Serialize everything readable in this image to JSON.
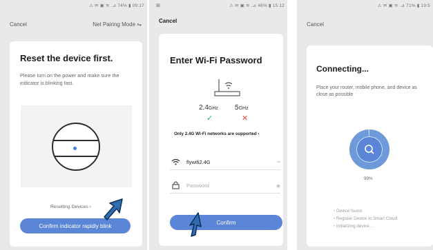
{
  "panel1": {
    "status_bar": "⚠ ✉ ▣ ≋ .⊿ 74% ▮ 09:17",
    "cancel_label": "Cancel",
    "mode_label": "Net Pairing Mode ⇋",
    "title": "Reset the device first.",
    "description": "Please turn on the power and make sure the indicator is blinking fast.",
    "resetting_link": "Resetting Devices ›",
    "confirm_button": "Confirm indicator rapidly blink"
  },
  "panel2": {
    "status_left": "⊠",
    "status_bar": "⚠ ✉ ▣ ≋ .⊿ 46% ▮ 15:12",
    "cancel_label": "Cancel",
    "title": "Enter Wi-Fi Password",
    "freq_24_main": "2.4",
    "freq_24_unit": "GHz",
    "freq_5_main": "5",
    "freq_5_unit": "GHz",
    "supported_ok": "✓",
    "supported_no": "✕",
    "support_note": "Only 2.4G Wi-Fi networks are supported ›",
    "wifi_name": "flywifi2.4G",
    "wifi_aux": "⇋",
    "password_placeholder": "Password",
    "password_value": "",
    "eye_icon": "◉",
    "confirm_button": "Confirm"
  },
  "panel3": {
    "status_bar": "⚠ ✉ ▣ ≋ .⊿ 71% ▮ 19:5",
    "cancel_label": "Cancel",
    "title": "Connecting...",
    "description": "Place your router, mobile phone, and device as close as possible",
    "progress_label": "99%",
    "progress_value": 0.99,
    "steps": [
      "Device found",
      "Register Device to Smart Cloud",
      "Initializing device..."
    ]
  },
  "colors": {
    "accent": "#5b86d8",
    "device_indicator": "#3a7ff2",
    "check_green": "#27ae60",
    "cross_red": "#e74c3c",
    "progress_ring": "#6e9ad9",
    "progress_track": "#c9dbf1"
  }
}
